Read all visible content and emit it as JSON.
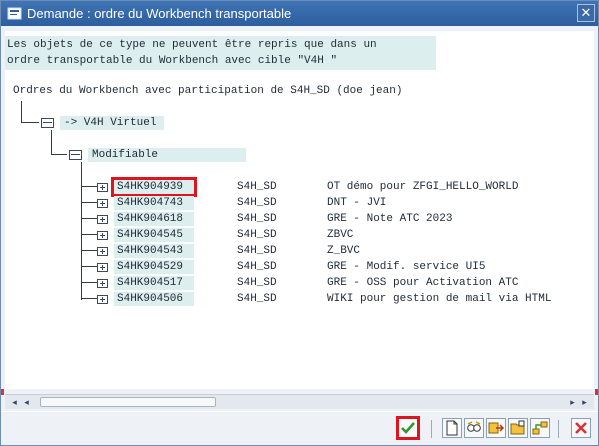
{
  "window": {
    "title": "Demande : ordre du Workbench transportable",
    "close_label": "✕"
  },
  "message": {
    "line1": "Les objets de ce type ne peuvent être repris que dans un",
    "line2": "ordre transportable du Workbench avec cible \"V4H \""
  },
  "tree": {
    "header": "Ordres du Workbench avec participation de S4H_SD (doe jean)",
    "target_node": "-> V4H Virtuel",
    "status_node": "Modifiable",
    "rows": [
      {
        "request": "S4HK904939",
        "target": "S4H_SD",
        "description": "OT démo pour ZFGI_HELLO_WORLD",
        "selected": true
      },
      {
        "request": "S4HK904743",
        "target": "S4H_SD",
        "description": "DNT - JVI",
        "selected": false
      },
      {
        "request": "S4HK904618",
        "target": "S4H_SD",
        "description": "GRE - Note ATC 2023",
        "selected": false
      },
      {
        "request": "S4HK904545",
        "target": "S4H_SD",
        "description": "ZBVC",
        "selected": false
      },
      {
        "request": "S4HK904543",
        "target": "S4H_SD",
        "description": "Z_BVC",
        "selected": false
      },
      {
        "request": "S4HK904529",
        "target": "S4H_SD",
        "description": "GRE - Modif. service UI5",
        "selected": false
      },
      {
        "request": "S4HK904517",
        "target": "S4H_SD",
        "description": "GRE - OSS pour Activation ATC",
        "selected": false
      },
      {
        "request": "S4HK904506",
        "target": "S4H_SD",
        "description": "WIKI pour gestion de mail via HTML",
        "selected": false
      }
    ]
  },
  "toolbar": {
    "buttons": [
      {
        "name": "ok-icon"
      },
      {
        "name": "new-document-icon"
      },
      {
        "name": "find-icon"
      },
      {
        "name": "transport-icon"
      },
      {
        "name": "folder-tree-icon"
      },
      {
        "name": "hierarchy-icon"
      },
      {
        "name": "cancel-icon"
      }
    ]
  },
  "colors": {
    "titlebar": "#2d5e9e",
    "highlight_bg": "#dceeed",
    "selection_border": "#e0141e",
    "ok_green": "#2e9a2a",
    "cancel_red": "#d8323a"
  }
}
